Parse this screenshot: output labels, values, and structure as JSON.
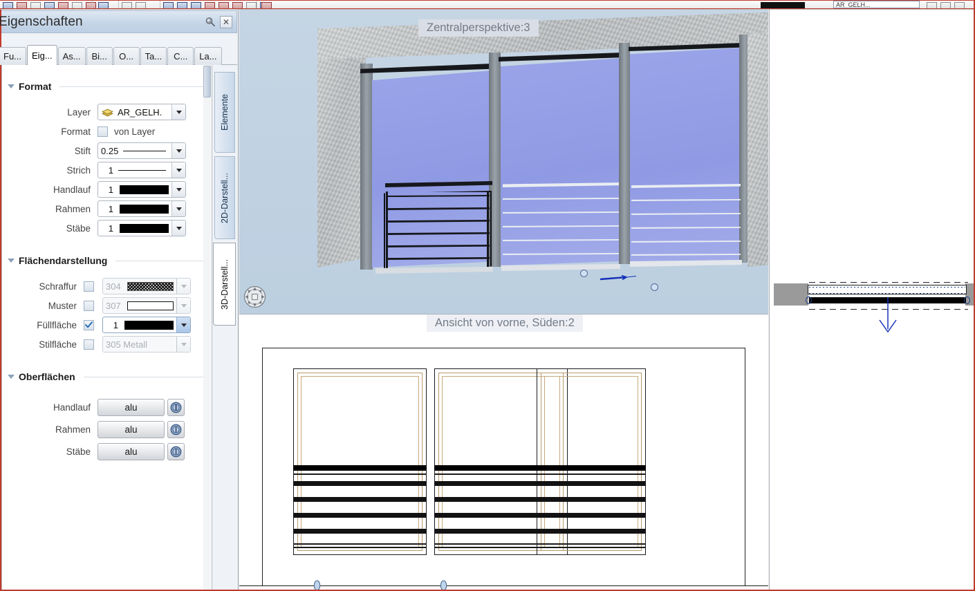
{
  "app": {
    "palette_title": "Eigenschaften",
    "pin_icon": "pin-icon",
    "close_label": "✕"
  },
  "toolbar": {
    "layer_field_value": "AR_GELH..."
  },
  "tabs": [
    {
      "label": "Fu...",
      "active": false
    },
    {
      "label": "Eig...",
      "active": true
    },
    {
      "label": "As...",
      "active": false
    },
    {
      "label": "Bi...",
      "active": false
    },
    {
      "label": "O...",
      "active": false
    },
    {
      "label": "Ta...",
      "active": false
    },
    {
      "label": "C...",
      "active": false
    },
    {
      "label": "La...",
      "active": false
    }
  ],
  "side_tabs": [
    {
      "label": "Elemente",
      "active": false
    },
    {
      "label": "2D-Darstell...",
      "active": false
    },
    {
      "label": "3D-Darstell...",
      "active": true
    }
  ],
  "sections": {
    "format": {
      "title": "Format",
      "rows": {
        "layer": {
          "label": "Layer",
          "value": "AR_GELH."
        },
        "format": {
          "label": "Format",
          "checkbox_label": "von Layer",
          "checked": false
        },
        "stift": {
          "label": "Stift",
          "value": "0.25"
        },
        "strich": {
          "label": "Strich",
          "value": "1"
        },
        "handlauf": {
          "label": "Handlauf",
          "value": "1"
        },
        "rahmen": {
          "label": "Rahmen",
          "value": "1"
        },
        "staebe": {
          "label": "Stäbe",
          "value": "1"
        }
      }
    },
    "flaechendarstellung": {
      "title": "Flächendarstellung",
      "rows": {
        "schraffur": {
          "label": "Schraffur",
          "value": "304",
          "checked": false,
          "enabled": false
        },
        "muster": {
          "label": "Muster",
          "value": "307",
          "checked": false,
          "enabled": false
        },
        "fuellflaeche": {
          "label": "Füllfläche",
          "value": "1",
          "checked": true,
          "enabled": true
        },
        "stilflaeche": {
          "label": "Stilfläche",
          "value": "305 Metall",
          "checked": false,
          "enabled": false
        }
      }
    },
    "oberflaechen": {
      "title": "Oberflächen",
      "rows": {
        "handlauf": {
          "label": "Handlauf",
          "value": "alu"
        },
        "rahmen": {
          "label": "Rahmen",
          "value": "alu"
        },
        "staebe": {
          "label": "Stäbe",
          "value": "alu"
        }
      }
    }
  },
  "viewports": {
    "perspective": {
      "label": "Zentralperspektive:3"
    },
    "elevation": {
      "label": "Ansicht von vorne, Süden:2"
    }
  },
  "colors": {
    "accent_blue": "#4c6a92",
    "sky": "#c3d4e3",
    "glass": "#8f9ae4",
    "concrete": "#bdc1c3",
    "red_border": "#c0392b",
    "panel_bg": "#eff2f6"
  }
}
